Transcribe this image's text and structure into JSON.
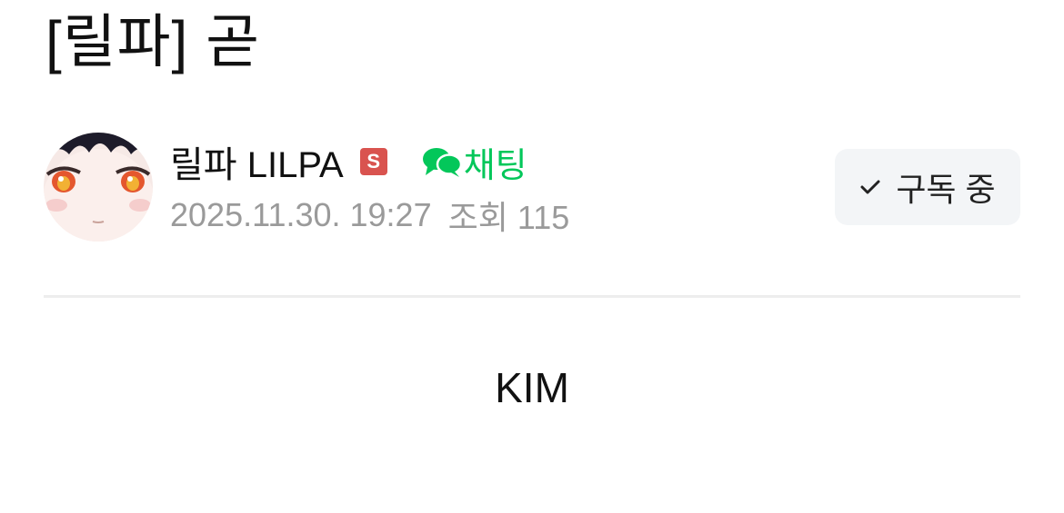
{
  "post": {
    "title": "[릴파] 곧",
    "body": "KIM"
  },
  "author": {
    "name": "릴파 LILPA",
    "badge": "S",
    "chat_label": "채팅",
    "date": "2025.11.30. 19:27",
    "views": "조회 115"
  },
  "subscribe": {
    "label": "구독 중",
    "icon": "check-icon"
  },
  "icons": {
    "avatar": "profile-avatar",
    "chat": "chat-bubbles-icon"
  },
  "colors": {
    "chat_green": "#03c75a",
    "badge_red": "#d9534f",
    "meta_gray": "#9a9a9a",
    "button_bg": "#f3f5f7"
  }
}
